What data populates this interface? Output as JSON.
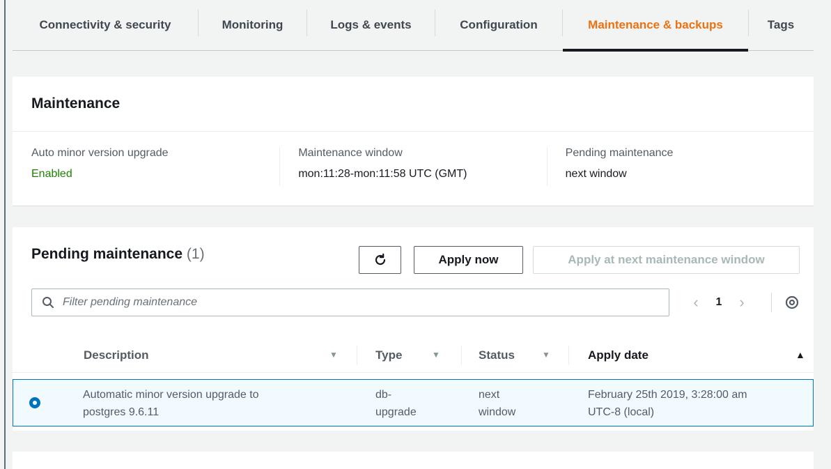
{
  "tabs": [
    {
      "label": "Connectivity & security"
    },
    {
      "label": "Monitoring"
    },
    {
      "label": "Logs & events"
    },
    {
      "label": "Configuration"
    },
    {
      "label": "Maintenance & backups"
    },
    {
      "label": "Tags"
    }
  ],
  "active_tab": "Maintenance & backups",
  "maintenance": {
    "title": "Maintenance",
    "auto_minor_label": "Auto minor version upgrade",
    "auto_minor_value": "Enabled",
    "window_label": "Maintenance window",
    "window_value": "mon:11:28-mon:11:58 UTC (GMT)",
    "pending_label": "Pending maintenance",
    "pending_value": "next window"
  },
  "pending": {
    "title": "Pending maintenance",
    "count": "(1)",
    "apply_now_label": "Apply now",
    "apply_next_label": "Apply at next maintenance window",
    "filter_placeholder": "Filter pending maintenance",
    "page": "1",
    "columns": {
      "description": "Description",
      "type": "Type",
      "status": "Status",
      "apply_date": "Apply date"
    },
    "rows": [
      {
        "description_l1": "Automatic minor version upgrade to",
        "description_l2": "postgres 9.6.11",
        "type_l1": "db-",
        "type_l2": "upgrade",
        "status_l1": "next",
        "status_l2": "window",
        "apply_date_l1": "February 25th 2019, 3:28:00 am",
        "apply_date_l2": "UTC-8 (local)"
      }
    ]
  },
  "colors": {
    "accent": "#ec7211",
    "enabled": "#1d8102",
    "selected_border": "#0073bb"
  },
  "icons": {
    "refresh": "refresh-icon",
    "search": "search-icon",
    "prev": "chevron-left-icon",
    "next": "chevron-right-icon",
    "settings": "gear-icon"
  }
}
